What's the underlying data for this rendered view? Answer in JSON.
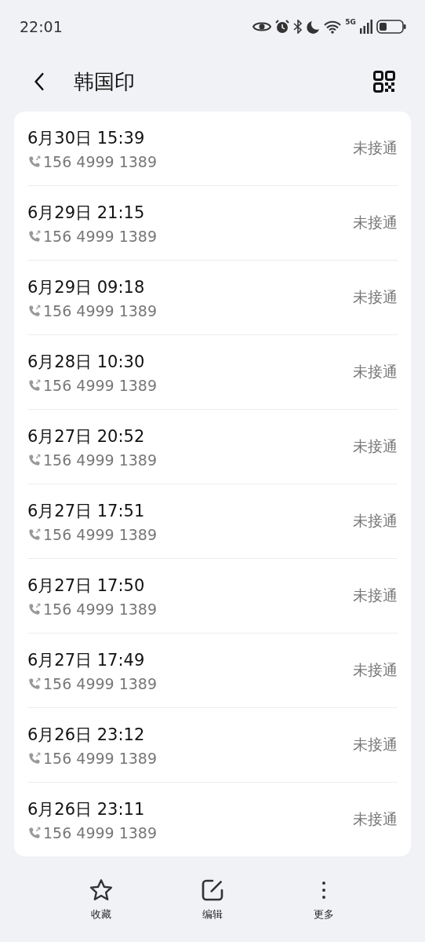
{
  "status_bar": {
    "time": "22:01",
    "network": "5G"
  },
  "header": {
    "title": "韩国印"
  },
  "calls": [
    {
      "datetime": "6月30日 15:39",
      "number": "156 4999 1389",
      "status": "未接通"
    },
    {
      "datetime": "6月29日 21:15",
      "number": "156 4999 1389",
      "status": "未接通"
    },
    {
      "datetime": "6月29日 09:18",
      "number": "156 4999 1389",
      "status": "未接通"
    },
    {
      "datetime": "6月28日 10:30",
      "number": "156 4999 1389",
      "status": "未接通"
    },
    {
      "datetime": "6月27日 20:52",
      "number": "156 4999 1389",
      "status": "未接通"
    },
    {
      "datetime": "6月27日 17:51",
      "number": "156 4999 1389",
      "status": "未接通"
    },
    {
      "datetime": "6月27日 17:50",
      "number": "156 4999 1389",
      "status": "未接通"
    },
    {
      "datetime": "6月27日 17:49",
      "number": "156 4999 1389",
      "status": "未接通"
    },
    {
      "datetime": "6月26日 23:12",
      "number": "156 4999 1389",
      "status": "未接通"
    },
    {
      "datetime": "6月26日 23:11",
      "number": "156 4999 1389",
      "status": "未接通"
    }
  ],
  "actions": [
    {
      "kind": "star",
      "label": "收藏"
    },
    {
      "kind": "edit",
      "label": "编辑"
    },
    {
      "kind": "more",
      "label": "更多"
    }
  ]
}
